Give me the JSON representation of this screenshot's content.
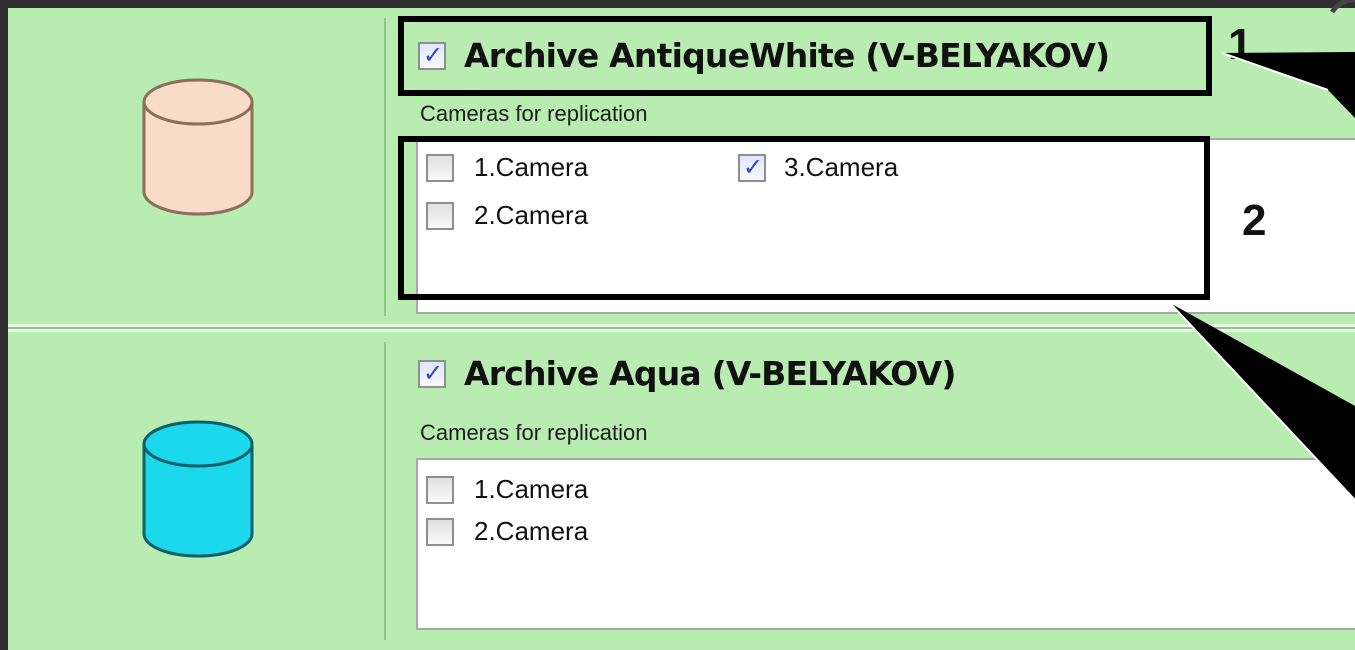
{
  "archives": [
    {
      "name": "Archive AntiqueWhite (V-BELYAKOV)",
      "checked": true,
      "icon": "database-cylinder-icon",
      "icon_fill": "#f8dcc8",
      "cameras_label": "Cameras for replication",
      "cameras": [
        {
          "label": "1.Camera",
          "checked": false
        },
        {
          "label": "2.Camera",
          "checked": false
        },
        {
          "label": "3.Camera",
          "checked": true
        }
      ]
    },
    {
      "name": "Archive Aqua (V-BELYAKOV)",
      "checked": true,
      "icon": "database-cylinder-icon",
      "icon_fill": "#1cd8ec",
      "cameras_label": "Cameras for replication",
      "cameras": [
        {
          "label": "1.Camera",
          "checked": false
        },
        {
          "label": "2.Camera",
          "checked": false
        }
      ]
    }
  ],
  "callouts": [
    {
      "number": "1"
    },
    {
      "number": "2"
    }
  ],
  "colors": {
    "panel_background": "#b8ecb0",
    "window_background": "#2e2e2e",
    "check_mark": "#2d46c2"
  }
}
